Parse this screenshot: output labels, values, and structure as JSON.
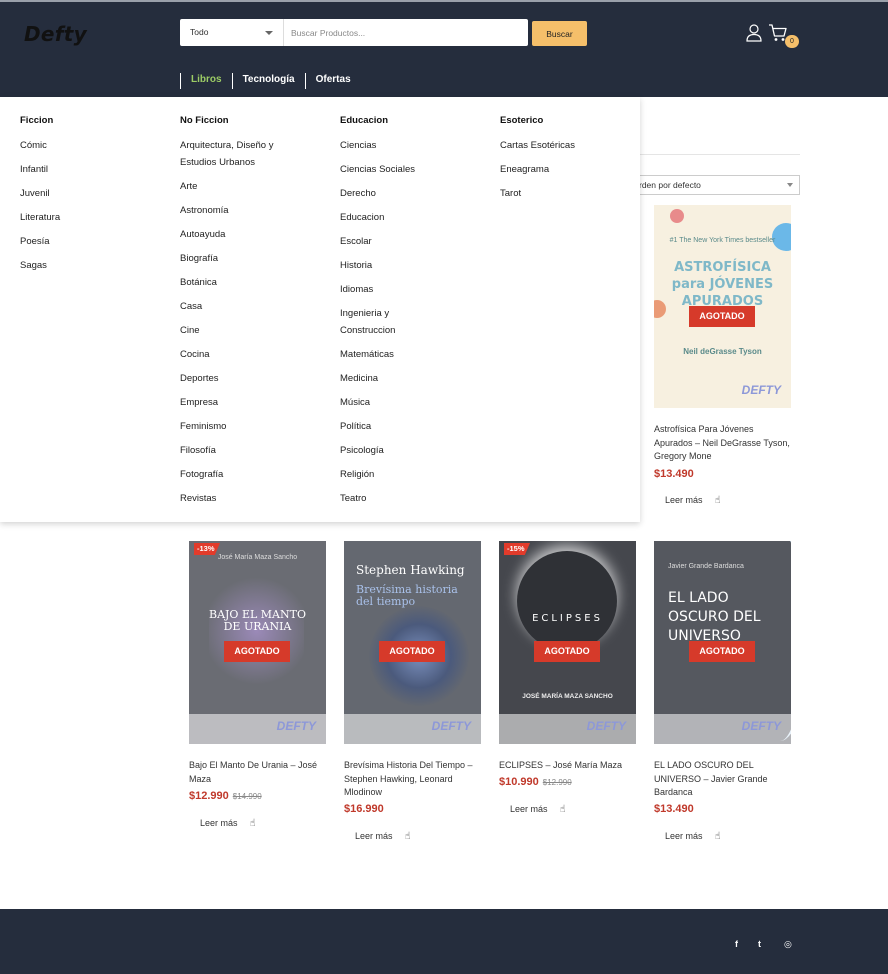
{
  "brand": {
    "logo": "Defty"
  },
  "search": {
    "category": "Todo",
    "placeholder": "Buscar Productos...",
    "button": "Buscar"
  },
  "header": {
    "cart_count": "0",
    "icons": [
      "user-icon",
      "cart-icon"
    ]
  },
  "nav": {
    "items": [
      "Libros",
      "Tecnología",
      "Ofertas"
    ]
  },
  "toolbar": {
    "sort": "rden por defecto"
  },
  "mega_menu": {
    "columns": [
      {
        "heading": "Ficcion",
        "items": [
          "Cómic",
          "Infantil",
          "Juvenil",
          "Literatura",
          "Poesía",
          "Sagas"
        ]
      },
      {
        "heading": "No Ficcion",
        "items": [
          "Arquitectura, Diseño y Estudios Urbanos",
          "Arte",
          "Astronomía",
          "Autoayuda",
          "Biografía",
          "Botánica",
          "Casa",
          "Cine",
          "Cocina",
          "Deportes",
          "Empresa",
          "Feminismo",
          "Filosofía",
          "Fotografía",
          "Revistas"
        ]
      },
      {
        "heading": "Educacion",
        "items": [
          "Ciencias",
          "Ciencias Sociales",
          "Derecho",
          "Educacion",
          "Escolar",
          "Historia",
          "Idiomas",
          "Ingenieria y Construccion",
          "Matemáticas",
          "Medicina",
          "Música",
          "Política",
          "Psicología",
          "Religión",
          "Teatro"
        ]
      },
      {
        "heading": "Esoterico",
        "items": [
          "Cartas Esotéricas",
          "Eneagrama",
          "Tarot"
        ]
      }
    ]
  },
  "products": [
    {
      "title": "Astrofísica Para Jóvenes Apurados – Neil DeGrasse Tyson, Gregory Mone",
      "price": "$13.490",
      "old_price": "",
      "badge": "",
      "status": "AGOTADO",
      "more": "Leer más",
      "cover_text": "ASTROFÍSICA para JÓVENES APURADOS",
      "cover_top": "#1 The New York Times bestseller",
      "cover_author": "Neil deGrasse Tyson",
      "cover_brand": "DEFTY"
    },
    {
      "title": "Bajo El Manto De Urania – José Maza",
      "price": "$12.990",
      "old_price": "$14.990",
      "badge": "-13%",
      "status": "AGOTADO",
      "more": "Leer más",
      "cover_text": "BAJO EL MANTO DE URANIA",
      "cover_top": "José María Maza Sancho",
      "cover_brand": "DEFTY"
    },
    {
      "title": "Brevísima Historia Del Tiempo – Stephen Hawking, Leonard Mlodinow",
      "price": "$16.990",
      "old_price": "",
      "badge": "",
      "status": "AGOTADO",
      "more": "Leer más",
      "cover_text": "Stephen Hawking",
      "cover_top": "Brevísima historia del tiempo",
      "cover_brand": "DEFTY"
    },
    {
      "title": "ECLIPSES – José María Maza",
      "price": "$10.990",
      "old_price": "$12.990",
      "badge": "-15%",
      "status": "AGOTADO",
      "more": "Leer más",
      "cover_text": "ECLIPSES",
      "cover_top": "JOSÉ MARÍA MAZA SANCHO",
      "cover_brand": "DEFTY"
    },
    {
      "title": "EL LADO OSCURO DEL UNIVERSO – Javier Grande Bardanca",
      "price": "$13.490",
      "old_price": "",
      "badge": "",
      "status": "AGOTADO",
      "more": "Leer más",
      "cover_text": "EL LADO OSCURO DEL UNIVERSO",
      "cover_top": "Javier Grande Bardanca",
      "cover_brand": "DEFTY"
    }
  ],
  "footer": {
    "social": [
      "f",
      "t",
      "◎"
    ],
    "icons": [
      "facebook-icon",
      "twitter-icon",
      "instagram-icon"
    ]
  },
  "colors": {
    "header_bg": "#252d3d",
    "accent": "#f5bf6a",
    "active_nav": "#9ccc65",
    "price": "#c0392b",
    "sold_out": "#d63a2a"
  }
}
